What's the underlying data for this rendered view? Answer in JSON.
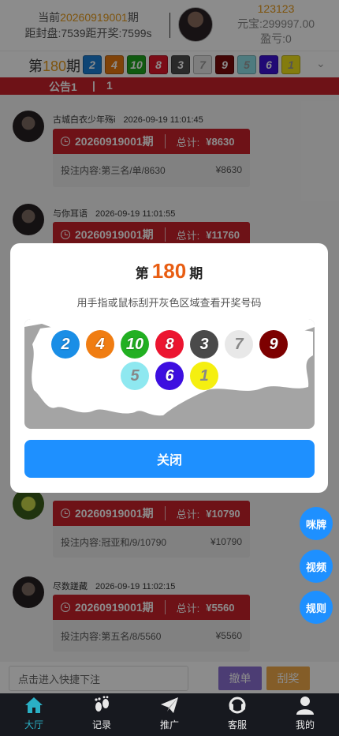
{
  "header": {
    "current_prefix": "当前",
    "current_issue": "20260919001",
    "current_suffix": "期",
    "countdown": "距封盘:7539距开奖:7599s",
    "user_id": "123123",
    "balance": "元宝:299997.00",
    "profit": "盈亏:0"
  },
  "issue_bar": {
    "prefix": "第",
    "issue": "180",
    "suffix": "期",
    "balls": [
      {
        "num": "2",
        "color": "#1a7fd6"
      },
      {
        "num": "4",
        "color": "#e8780f"
      },
      {
        "num": "10",
        "color": "#1ea51e"
      },
      {
        "num": "8",
        "color": "#e0162b"
      },
      {
        "num": "3",
        "color": "#4d4d4d"
      },
      {
        "num": "7",
        "color": "#e6e6e6"
      },
      {
        "num": "9",
        "color": "#7a0a0a"
      },
      {
        "num": "5",
        "color": "#8ee0e8"
      },
      {
        "num": "6",
        "color": "#3c12d6"
      },
      {
        "num": "1",
        "color": "#f0e21a"
      }
    ]
  },
  "notice": {
    "label": "公告1",
    "divider": "|",
    "count": "1"
  },
  "feed": [
    {
      "user": "古城白衣少年殇i",
      "time": "2026-09-19 11:01:45",
      "issue": "20260919001期",
      "total_label": "总计:",
      "total": "¥8630",
      "content": "投注内容:第三名/单/8630",
      "amount": "¥8630"
    },
    {
      "user": "与你耳语",
      "time": "2026-09-19 11:01:55",
      "issue": "20260919001期",
      "total_label": "总计:",
      "total": "¥11760"
    },
    {
      "user": "",
      "time": "",
      "issue": "20260919001期",
      "total_label": "总计:",
      "total": "¥10790",
      "content": "投注内容:冠亚和/9/10790",
      "amount": "¥10790"
    },
    {
      "user": "尽数蹉藏",
      "time": "2026-09-19 11:02:15",
      "issue": "20260919001期",
      "total_label": "总计:",
      "total": "¥5560",
      "content": "投注内容:第五名/8/5560",
      "amount": "¥5560"
    }
  ],
  "float_buttons": [
    "咪牌",
    "视频",
    "规则"
  ],
  "input_bar": {
    "placeholder": "点击进入快捷下注",
    "cancel": "撤单",
    "scratch": "刮奖"
  },
  "tabs": [
    {
      "label": "大厅",
      "icon": "home-icon",
      "active": true
    },
    {
      "label": "记录",
      "icon": "footprint-icon",
      "active": false
    },
    {
      "label": "推广",
      "icon": "paper-plane-icon",
      "active": false
    },
    {
      "label": "客服",
      "icon": "headset-icon",
      "active": false
    },
    {
      "label": "我的",
      "icon": "user-icon",
      "active": false
    }
  ],
  "modal": {
    "prefix": "第",
    "issue": "180",
    "suffix": "期",
    "hint": "用手指或鼠标刮开灰色区域查看开奖号码",
    "balls_row1": [
      {
        "num": "2",
        "color": "#1a8ee6"
      },
      {
        "num": "4",
        "color": "#f07d12"
      },
      {
        "num": "10",
        "color": "#22b022"
      },
      {
        "num": "8",
        "color": "#ec1530"
      },
      {
        "num": "3",
        "color": "#4a4a4a"
      },
      {
        "num": "7",
        "color": "#e8e8e8"
      },
      {
        "num": "9",
        "color": "#7d0000"
      }
    ],
    "balls_row2": [
      {
        "num": "5",
        "color": "#8ee8f0"
      },
      {
        "num": "6",
        "color": "#3d0fe0"
      },
      {
        "num": "1",
        "color": "#f5ef10"
      }
    ],
    "close": "关闭"
  }
}
